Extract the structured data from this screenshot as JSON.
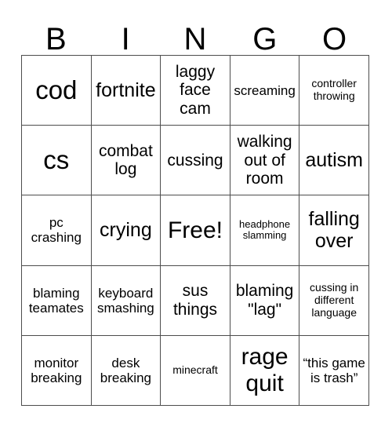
{
  "header": {
    "letters": [
      "B",
      "I",
      "N",
      "G",
      "O"
    ]
  },
  "grid": {
    "rows": [
      [
        {
          "text": "cod",
          "size": "fs-xxl"
        },
        {
          "text": "fortnite",
          "size": "fs-lg"
        },
        {
          "text": "laggy face cam",
          "size": "fs-md"
        },
        {
          "text": "screaming",
          "size": "fs-sm"
        },
        {
          "text": "controller throwing",
          "size": "fs-xs"
        }
      ],
      [
        {
          "text": "cs",
          "size": "fs-xxl"
        },
        {
          "text": "combat log",
          "size": "fs-md"
        },
        {
          "text": "cussing",
          "size": "fs-md"
        },
        {
          "text": "walking out of room",
          "size": "fs-md"
        },
        {
          "text": "autism",
          "size": "fs-lg"
        }
      ],
      [
        {
          "text": "pc crashing",
          "size": "fs-sm"
        },
        {
          "text": "crying",
          "size": "fs-lg"
        },
        {
          "text": "Free!",
          "size": "fs-xl"
        },
        {
          "text": "headphone slamming",
          "size": "fs-xxs"
        },
        {
          "text": "falling over",
          "size": "fs-lg"
        }
      ],
      [
        {
          "text": "blaming teamates",
          "size": "fs-sm"
        },
        {
          "text": "keyboard smashing",
          "size": "fs-sm"
        },
        {
          "text": "sus things",
          "size": "fs-md"
        },
        {
          "text": "blaming \"lag\"",
          "size": "fs-md"
        },
        {
          "text": "cussing in different language",
          "size": "fs-xs"
        }
      ],
      [
        {
          "text": "monitor breaking",
          "size": "fs-sm"
        },
        {
          "text": "desk breaking",
          "size": "fs-sm"
        },
        {
          "text": "minecraft",
          "size": "fs-xs"
        },
        {
          "text": "rage quit",
          "size": "fs-xl"
        },
        {
          "text": "“this game is trash”",
          "size": "fs-sm"
        }
      ]
    ]
  },
  "colors": {
    "grid_line": "#4d4d4d",
    "text": "#000000",
    "background": "#ffffff"
  }
}
